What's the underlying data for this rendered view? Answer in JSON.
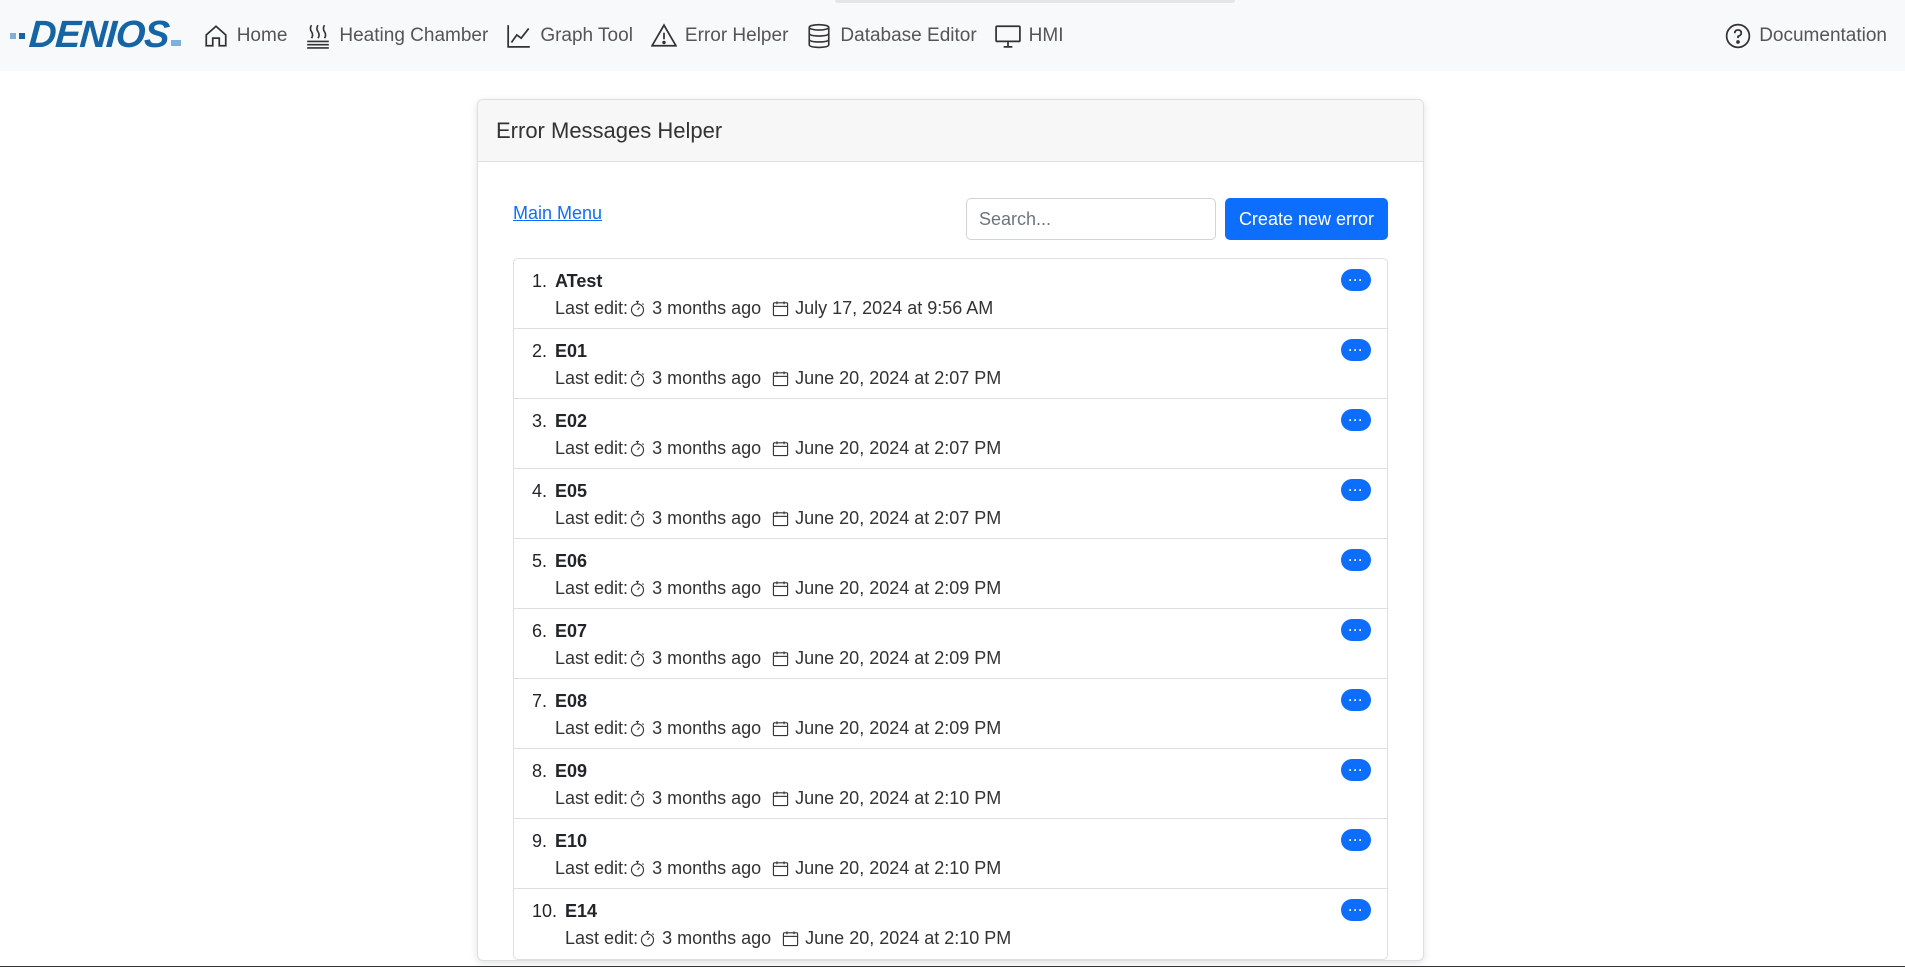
{
  "brand": {
    "name": "DENIOS"
  },
  "nav": {
    "items": [
      {
        "label": "Home",
        "icon": "home-icon"
      },
      {
        "label": "Heating Chamber",
        "icon": "heat-icon"
      },
      {
        "label": "Graph Tool",
        "icon": "graph-icon"
      },
      {
        "label": "Error Helper",
        "icon": "warning-icon"
      },
      {
        "label": "Database Editor",
        "icon": "database-icon"
      },
      {
        "label": "HMI",
        "icon": "monitor-icon"
      }
    ],
    "documentation": {
      "label": "Documentation",
      "icon": "question-circle-icon"
    }
  },
  "card": {
    "title": "Error Messages Helper",
    "main_menu_label": "Main Menu",
    "search_placeholder": "Search...",
    "create_button_label": "Create new error"
  },
  "errors": [
    {
      "num": "1.",
      "code": "ATest",
      "last_edit_label": "Last edit:",
      "relative": "3 months ago",
      "date": "July 17, 2024 at 9:56 AM"
    },
    {
      "num": "2.",
      "code": "E01",
      "last_edit_label": "Last edit:",
      "relative": "3 months ago",
      "date": "June 20, 2024 at 2:07 PM"
    },
    {
      "num": "3.",
      "code": "E02",
      "last_edit_label": "Last edit:",
      "relative": "3 months ago",
      "date": "June 20, 2024 at 2:07 PM"
    },
    {
      "num": "4.",
      "code": "E05",
      "last_edit_label": "Last edit:",
      "relative": "3 months ago",
      "date": "June 20, 2024 at 2:07 PM"
    },
    {
      "num": "5.",
      "code": "E06",
      "last_edit_label": "Last edit:",
      "relative": "3 months ago",
      "date": "June 20, 2024 at 2:09 PM"
    },
    {
      "num": "6.",
      "code": "E07",
      "last_edit_label": "Last edit:",
      "relative": "3 months ago",
      "date": "June 20, 2024 at 2:09 PM"
    },
    {
      "num": "7.",
      "code": "E08",
      "last_edit_label": "Last edit:",
      "relative": "3 months ago",
      "date": "June 20, 2024 at 2:09 PM"
    },
    {
      "num": "8.",
      "code": "E09",
      "last_edit_label": "Last edit:",
      "relative": "3 months ago",
      "date": "June 20, 2024 at 2:10 PM"
    },
    {
      "num": "9.",
      "code": "E10",
      "last_edit_label": "Last edit:",
      "relative": "3 months ago",
      "date": "June 20, 2024 at 2:10 PM"
    },
    {
      "num": "10.",
      "code": "E14",
      "last_edit_label": "Last edit:",
      "relative": "3 months ago",
      "date": "June 20, 2024 at 2:10 PM"
    }
  ],
  "more_button_label": "···",
  "colors": {
    "primary": "#0d6efd",
    "brand": "#1565a6",
    "navbar_bg": "#f8f9fa"
  }
}
